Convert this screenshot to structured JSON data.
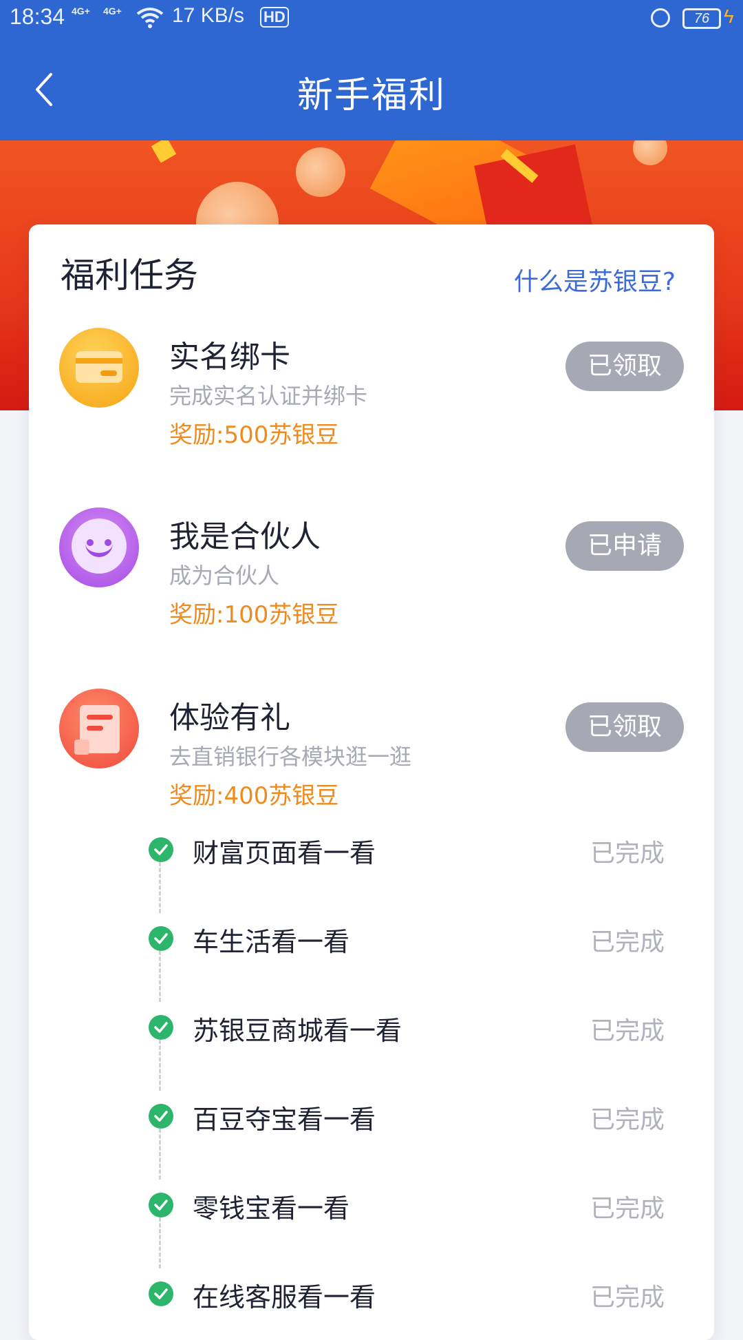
{
  "status_bar": {
    "time": "18:34",
    "signal_1": "4G+",
    "signal_2": "4G+",
    "speed": "17 KB/s",
    "hd": "HD",
    "battery": "76"
  },
  "nav": {
    "title": "新手福利",
    "back_icon": "chevron-left-icon"
  },
  "card": {
    "title": "福利任务",
    "link": "什么是苏银豆?"
  },
  "tasks": [
    {
      "name": "实名绑卡",
      "desc": "完成实名认证并绑卡",
      "reward": "奖励:500苏银豆",
      "button": "已领取",
      "icon": "bank-card-icon"
    },
    {
      "name": "我是合伙人",
      "desc": "成为合伙人",
      "reward": "奖励:100苏银豆",
      "button": "已申请",
      "icon": "smile-face-icon"
    },
    {
      "name": "体验有礼",
      "desc": "去直销银行各模块逛一逛",
      "reward": "奖励:400苏银豆",
      "button": "已领取",
      "icon": "document-icon"
    }
  ],
  "subtasks": [
    {
      "label": "财富页面看一看",
      "status": "已完成"
    },
    {
      "label": "车生活看一看",
      "status": "已完成"
    },
    {
      "label": "苏银豆商城看一看",
      "status": "已完成"
    },
    {
      "label": "百豆夺宝看一看",
      "status": "已完成"
    },
    {
      "label": "零钱宝看一看",
      "status": "已完成"
    },
    {
      "label": "在线客服看一看",
      "status": "已完成"
    }
  ],
  "colors": {
    "primary": "#2f67d2",
    "reward": "#ef8a1e",
    "disabled_button": "#a6a8b3",
    "check": "#2db56b"
  }
}
